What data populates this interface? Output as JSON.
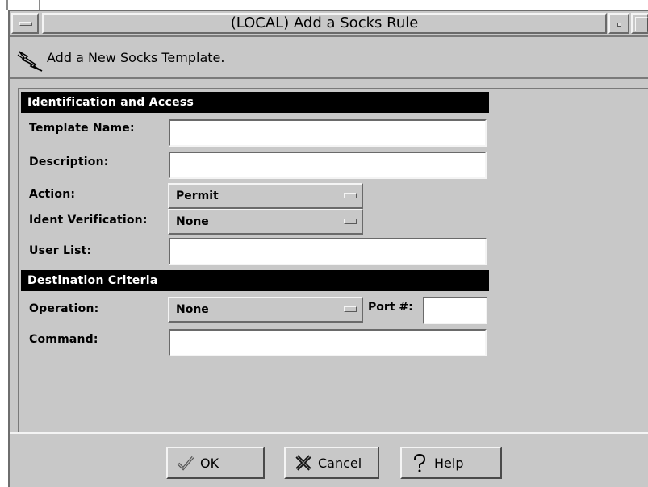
{
  "window": {
    "title": "(LOCAL) Add a Socks Rule"
  },
  "header": {
    "icon": "lightning-icon",
    "subtitle": "Add a New Socks Template."
  },
  "sections": {
    "identification": {
      "heading": "Identification and Access",
      "template_name_label": "Template Name:",
      "template_name_value": "",
      "description_label": "Description:",
      "description_value": "",
      "action_label": "Action:",
      "action_value": "Permit",
      "ident_label": "Ident Verification:",
      "ident_value": "None",
      "user_list_label": "User List:",
      "user_list_value": ""
    },
    "destination": {
      "heading": "Destination Criteria",
      "operation_label": "Operation:",
      "operation_value": "None",
      "port_label": "Port #:",
      "port_value": "",
      "command_label": "Command:",
      "command_value": ""
    }
  },
  "buttons": {
    "ok_label": "OK",
    "ok_icon": "checkmark-icon",
    "cancel_label": "Cancel",
    "cancel_icon": "x-mark-icon",
    "help_label": "Help",
    "help_icon": "question-mark-icon"
  }
}
